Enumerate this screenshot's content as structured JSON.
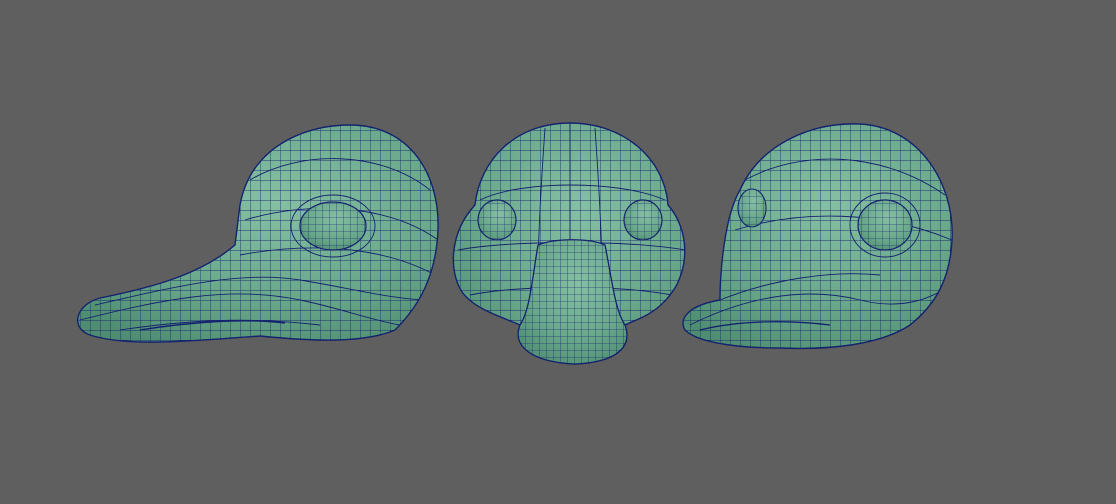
{
  "scene": {
    "background_color": "#5f5f5f",
    "mesh_fill_color": "#6aa88b",
    "mesh_shade_color": "#4f8d72",
    "mesh_highlight_color": "#86c0a4",
    "wire_color": "#14236e",
    "models": [
      {
        "id": "duck-head-side-left",
        "view": "left-side"
      },
      {
        "id": "duck-head-front",
        "view": "front"
      },
      {
        "id": "duck-head-side-right",
        "view": "three-quarter-right"
      }
    ]
  }
}
